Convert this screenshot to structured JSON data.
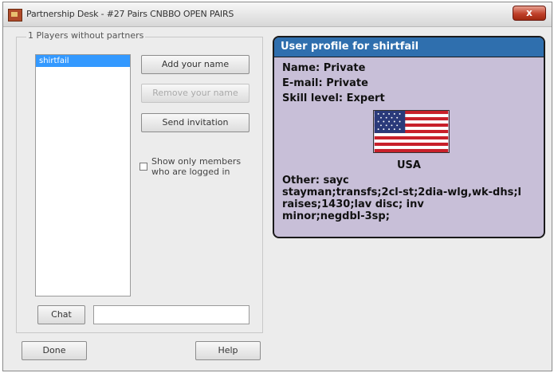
{
  "window": {
    "title": "Partnership Desk - #27 Pairs CNBBO OPEN PAIRS",
    "close_label": "x"
  },
  "left": {
    "group_label": "1 Players without partners",
    "players": [
      "shirtfail"
    ],
    "add_name_label": "Add your name",
    "remove_name_label": "Remove your name",
    "send_invitation_label": "Send invitation",
    "show_only_label": "Show only members who are logged in",
    "chat_label": "Chat",
    "chat_value": ""
  },
  "footer": {
    "done_label": "Done",
    "help_label": "Help"
  },
  "profile": {
    "header": "User profile for shirtfail",
    "name": "Name: Private",
    "email": "E-mail: Private",
    "skill": "Skill level: Expert",
    "country": "USA",
    "other": "Other: sayc\nstayman;transfs;2cl-st;2dia-wlg,wk-dhs;l\nraises;1430;lav disc; inv\nminor;negdbl-3sp;",
    "header_color": "#2f6fae",
    "background_color": "#c8bfd8"
  }
}
